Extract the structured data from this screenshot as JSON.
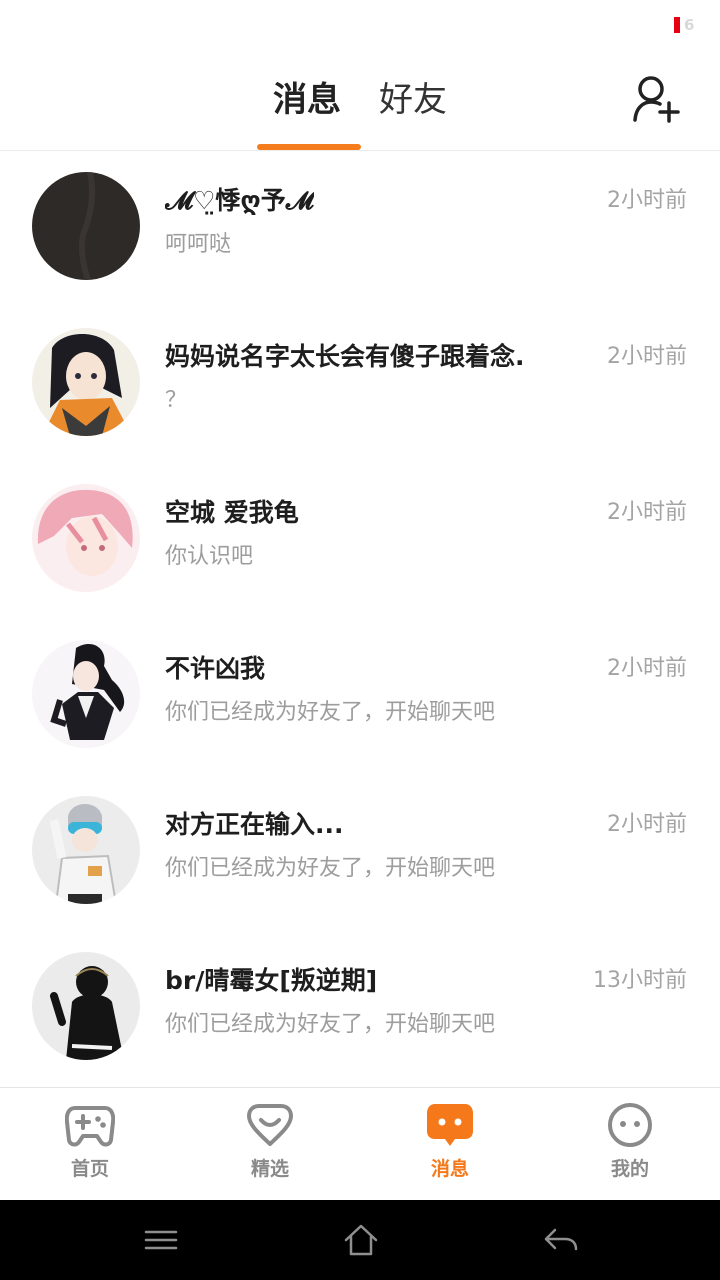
{
  "status": {
    "badge_number": "6"
  },
  "header": {
    "tabs": [
      {
        "label": "消息"
      },
      {
        "label": "好友"
      }
    ],
    "accent_color": "#f57d1e"
  },
  "messages": [
    {
      "name": "\u0000𝓜♡̤悴ღ\u0000予𝓜\u0000",
      "name_display": "𝓜♡̤悸ღ予𝓜",
      "preview": "呵呵哒",
      "time": "2小时前",
      "avatar": "dark-avatar"
    },
    {
      "name_display": "妈妈说名字太长会有傻子跟着念.",
      "preview": "？",
      "time": "2小时前",
      "avatar": "anime-girl-orange-avatar"
    },
    {
      "name_display": "空城 爱我龟",
      "preview": "你认识吧",
      "time": "2小时前",
      "avatar": "pink-hair-avatar"
    },
    {
      "name_display": "不许凶我",
      "preview": "你们已经成为好友了，开始聊天吧",
      "time": "2小时前",
      "avatar": "ponytail-girl-avatar"
    },
    {
      "name_display": "对方正在输入...",
      "preview": "你们已经成为好友了，开始聊天吧",
      "time": "2小时前",
      "avatar": "goggles-boy-avatar"
    },
    {
      "name_display": "br/晴霉女[叛逆期]",
      "preview": "你们已经成为好友了，开始聊天吧",
      "time": "13小时前",
      "avatar": "dark-hair-back-avatar"
    }
  ],
  "bottom_nav": [
    {
      "label": "首页",
      "icon": "gamepad-icon"
    },
    {
      "label": "精选",
      "icon": "heart-badge-icon"
    },
    {
      "label": "消息",
      "icon": "chat-bubble-icon",
      "active": true
    },
    {
      "label": "我的",
      "icon": "smiley-face-icon"
    }
  ],
  "system_nav": {
    "icons": [
      "menu-icon",
      "home-icon",
      "back-icon"
    ]
  }
}
